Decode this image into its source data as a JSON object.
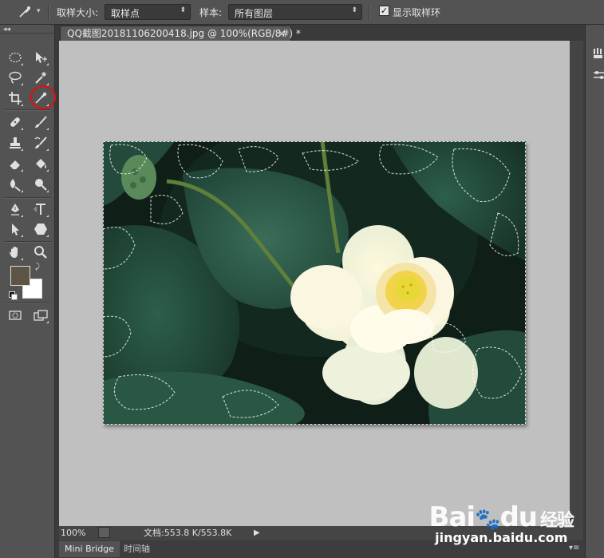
{
  "options_bar": {
    "sample_size_label": "取样大小:",
    "sample_size_value": "取样点",
    "sample_label": "样本:",
    "sample_value": "所有图层",
    "show_ring_label": "显示取样环",
    "show_ring_checked": true
  },
  "document": {
    "tab_title": "QQ截图20181106200418.jpg @ 100%(RGB/8#) *",
    "close_glyph": "×"
  },
  "status_bar": {
    "zoom": "100%",
    "doc_info": "文档:553.8 K/553.8K"
  },
  "panel_tabs": [
    "Mini Bridge",
    "时间轴"
  ],
  "colors": {
    "foreground": "#5e5446",
    "background": "#ffffff",
    "highlight_circle": "#e01010"
  },
  "watermark": {
    "brand": "Bai",
    "brand2": "du",
    "brand_cn": "经验",
    "url": "jingyan.baidu.com"
  },
  "icons": [
    "eyedropper-icon",
    "marquee-icon",
    "move-icon",
    "lasso-icon",
    "magic-wand-icon",
    "crop-icon",
    "eyedropper-tool-icon",
    "healing-icon",
    "brush-icon",
    "stamp-icon",
    "history-brush-icon",
    "eraser-icon",
    "paint-bucket-icon",
    "blur-icon",
    "dodge-icon",
    "pen-icon",
    "type-icon",
    "path-select-icon",
    "shape-icon",
    "hand-icon",
    "zoom-icon"
  ]
}
